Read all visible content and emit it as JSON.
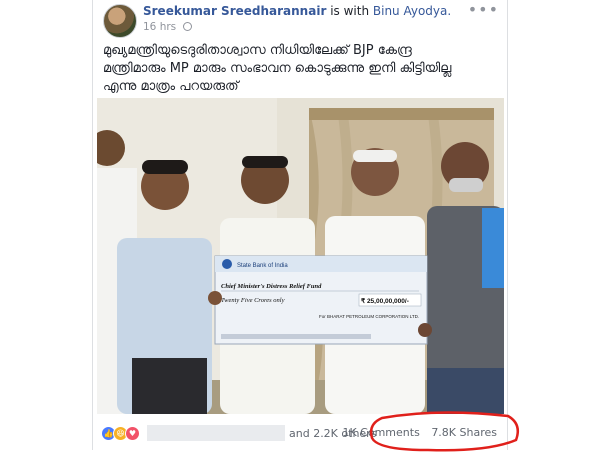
{
  "post": {
    "author": "Sreekumar Sreedharannair",
    "with_text": "is with",
    "tagged": "Binu Ayodya.",
    "time": "16 hrs",
    "more_label": "•••",
    "text_line1": "മുഖ്യമന്ത്രിയുടെദുരിതാശ്വാസ നിധിയിലേക്ക് BJP കേന്ദ്ര",
    "text_line2": "മന്ത്രിമാരും MP മാരും സംഭാവന കൊടുക്കുന്നു ഇനി കിട്ടിയില്ല",
    "text_line3": "എന്നു മാത്രം പറയരുത്"
  },
  "cheque": {
    "bank": "State Bank of India",
    "payee": "Chief Minister's Distress Relief Fund",
    "words": "Twenty Five Crores only",
    "amount": "₹ 25,00,00,000/-",
    "company": "For BHARAT PETROLEUM CORPORATION LTD."
  },
  "footer": {
    "others": "and 2.2K others",
    "comments": "1K Comments",
    "shares": "7.8K Shares"
  },
  "colors": {
    "link": "#365899",
    "highlight_circle": "#e0201b"
  }
}
